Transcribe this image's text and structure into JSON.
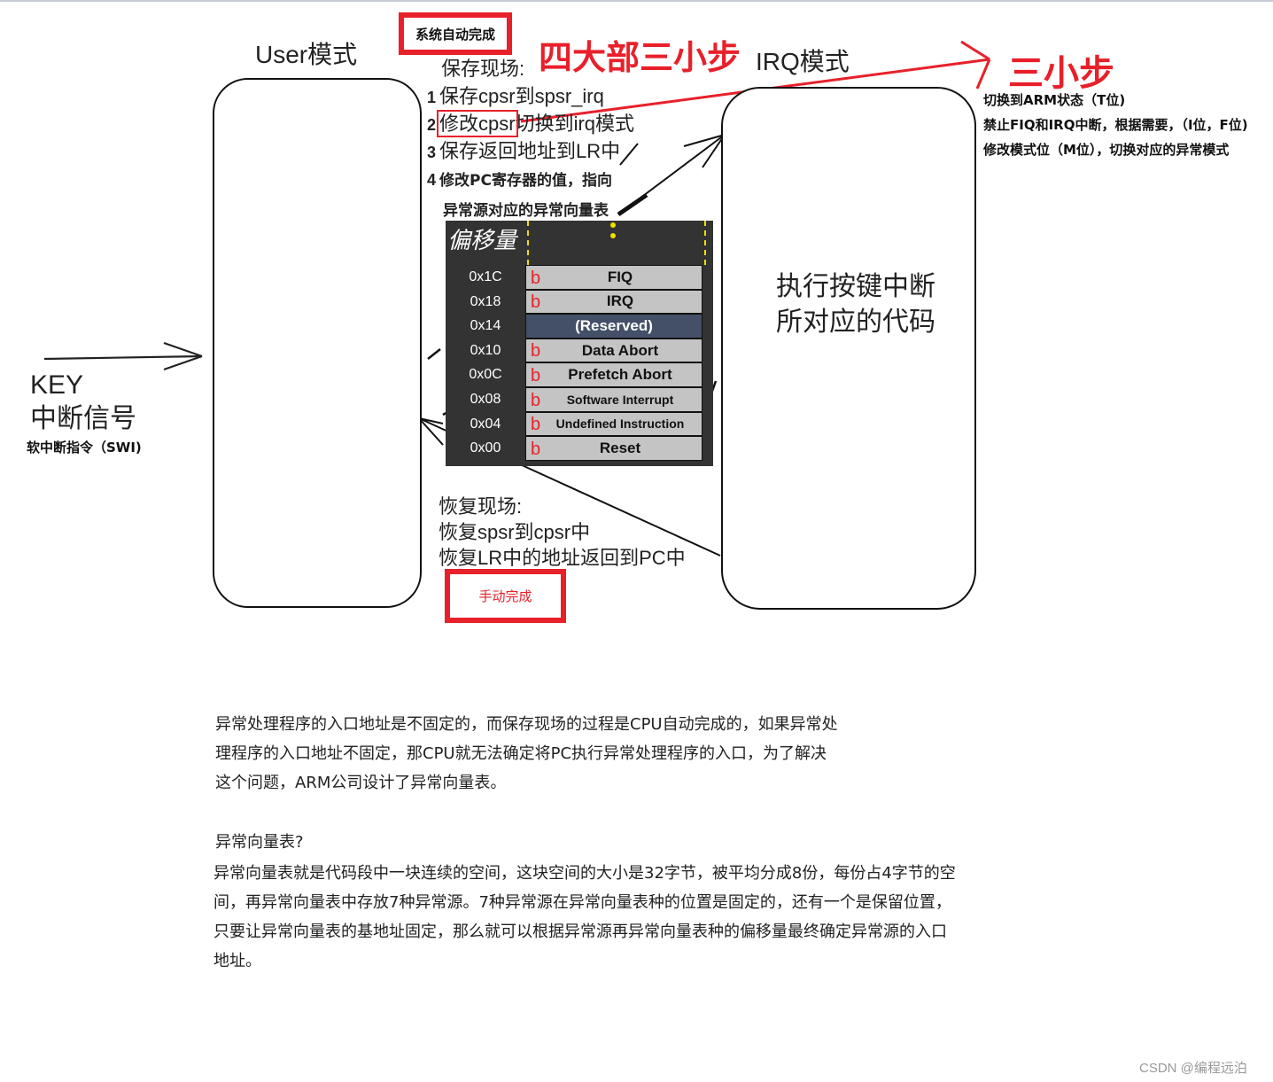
{
  "user_mode": {
    "label": "User模式"
  },
  "irq_mode": {
    "label": "IRQ模式",
    "code_lines": [
      "执行按键中断",
      "所对应的代码"
    ]
  },
  "auto_complete_badge": "系统自动完成",
  "manual_complete_badge": "手动完成",
  "headline": "四大部三小步",
  "three_steps": {
    "title": "三小步",
    "items": [
      "切换到ARM状态（T位)",
      "禁止FIQ和IRQ中断，根据需要，（I位，F位)",
      "修改模式位（M位），切换对应的异常模式"
    ]
  },
  "save_context": {
    "title": "保存现场:",
    "steps": [
      {
        "num": "1",
        "text": "保存cpsr到spsr_irq"
      },
      {
        "num": "2",
        "highlight": "修改cpsr",
        "text": "切换到irq模式"
      },
      {
        "num": "3",
        "text": "保存返回地址到LR中"
      },
      {
        "num": "4",
        "text": "修改PC寄存器的值，指向"
      },
      {
        "num": "",
        "text": "异常源对应的异常向量表"
      }
    ]
  },
  "vector_table": {
    "header": "偏移量",
    "branch_label": "b",
    "rows": [
      {
        "offset": "0x1C",
        "name": "FIQ",
        "branch": true
      },
      {
        "offset": "0x18",
        "name": "IRQ",
        "branch": true
      },
      {
        "offset": "0x14",
        "name": "(Reserved)",
        "branch": false,
        "reserved": true
      },
      {
        "offset": "0x10",
        "name": "Data Abort",
        "branch": true
      },
      {
        "offset": "0x0C",
        "name": "Prefetch Abort",
        "branch": true
      },
      {
        "offset": "0x08",
        "name": "Software Interrupt",
        "branch": true
      },
      {
        "offset": "0x04",
        "name": "Undefined Instruction",
        "branch": true
      },
      {
        "offset": "0x00",
        "name": "Reset",
        "branch": true
      }
    ]
  },
  "key_signal": {
    "line1": "KEY",
    "line2": "中断信号",
    "swi": "软中断指令（SWI)"
  },
  "restore_context": {
    "title": "恢复现场:",
    "lines": [
      "恢复spsr到cpsr中",
      "恢复LR中的地址返回到PC中"
    ]
  },
  "paragraphs": {
    "p1": "异常处理程序的入口地址是不固定的，而保存现场的过程是CPU自动完成的，如果异常处理程序的入口地址不固定，那CPU就无法确定将PC执行异常处理程序的入口，为了解决这个问题，ARM公司设计了异常向量表。",
    "q": "异常向量表?",
    "p2": "异常向量表就是代码段中一块连续的空间，这块空间的大小是32字节，被平均分成8份，每份占4字节的空间，再异常向量表中存放7种异常源。7种异常源在异常向量表种的位置是固定的，还有一个是保留位置，只要让异常向量表的基地址固定，那么就可以根据异常源再异常向量表种的偏移量最终确定异常源的入口地址。"
  },
  "watermark": "CSDN @编程远泊",
  "colors": {
    "accent_red": "#e8202a",
    "table_bg": "#333333",
    "cell_gray": "#c4c4c4",
    "reserved_blue": "#435068",
    "dashed_yellow": "#f0e000"
  }
}
